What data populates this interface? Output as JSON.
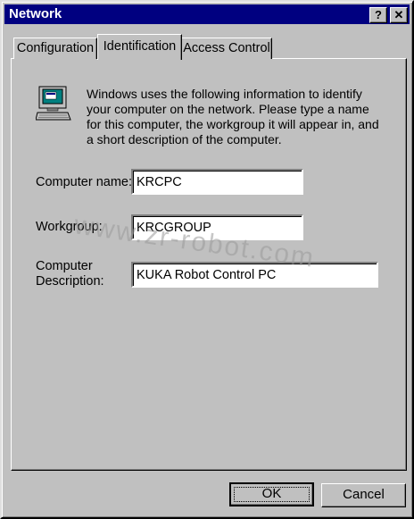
{
  "window": {
    "title": "Network",
    "help_button": "?",
    "close_button": "✕"
  },
  "tabs": [
    {
      "label": "Configuration"
    },
    {
      "label": "Identification"
    },
    {
      "label": "Access Control"
    }
  ],
  "identification": {
    "description": "Windows uses the following information to identify your computer on the network.  Please type a name for this computer, the workgroup it will appear in, and a short description of the computer.",
    "computer_name_label": "Computer name:",
    "computer_name_value": "KRCPC",
    "workgroup_label": "Workgroup:",
    "workgroup_value": "KRCGROUP",
    "description_label_line1": "Computer",
    "description_label_line2": "Description:",
    "description_value": "KUKA Robot Control PC"
  },
  "watermark": "www.zr-robot.com",
  "buttons": {
    "ok": "OK",
    "cancel": "Cancel"
  }
}
